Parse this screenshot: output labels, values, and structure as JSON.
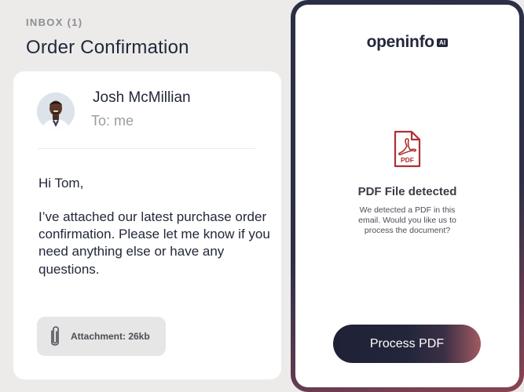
{
  "inbox": {
    "label": "INBOX (1)",
    "title": "Order Confirmation"
  },
  "email": {
    "sender": "Josh McMillian",
    "recipient": "To: me",
    "greeting": "Hi Tom,",
    "body": "I’ve attached our latest purchase order confirmation. Please let me know if you need anything else or have any questions.",
    "attachment_label": "Attachment: 26kb",
    "attachment_icon": "paperclip-icon"
  },
  "panel": {
    "brand": "openinfo",
    "brand_badge": "AI",
    "pdf_icon_label": "PDF",
    "detect_title": "PDF File detected",
    "detect_description": "We detected a PDF in this email. Would you like us to process the document?",
    "process_button": "Process PDF"
  },
  "colors": {
    "accent_dark": "#23283a",
    "accent_red": "#b03030",
    "gradient_end": "#a25a60"
  }
}
